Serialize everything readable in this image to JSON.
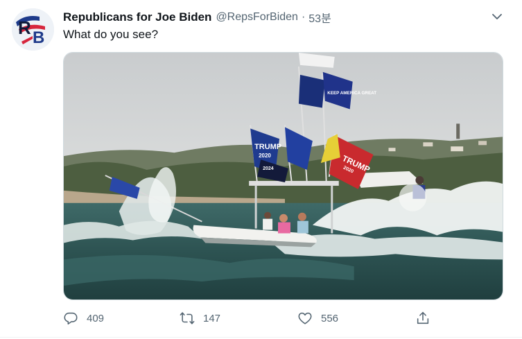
{
  "tweet": {
    "display_name": "Republicans for Joe Biden",
    "handle": "@RepsForBiden",
    "separator": "·",
    "time": "53분",
    "text": "What do you see?",
    "avatar_letters": "RB"
  },
  "media": {
    "flag_texts": [
      "TRUMP",
      "2020",
      "KEEP AMERICA GREAT",
      "2020",
      "2024"
    ]
  },
  "actions": {
    "reply_count": "409",
    "retweet_count": "147",
    "like_count": "556"
  },
  "icons": {
    "more": "chevron-down-icon",
    "reply": "reply-icon",
    "retweet": "retweet-icon",
    "like": "heart-icon",
    "share": "share-icon"
  },
  "colors": {
    "text": "#0f1419",
    "secondary": "#536471",
    "border": "#cfd9de",
    "avatar_red": "#d7263d",
    "avatar_blue": "#1e3a8a"
  }
}
